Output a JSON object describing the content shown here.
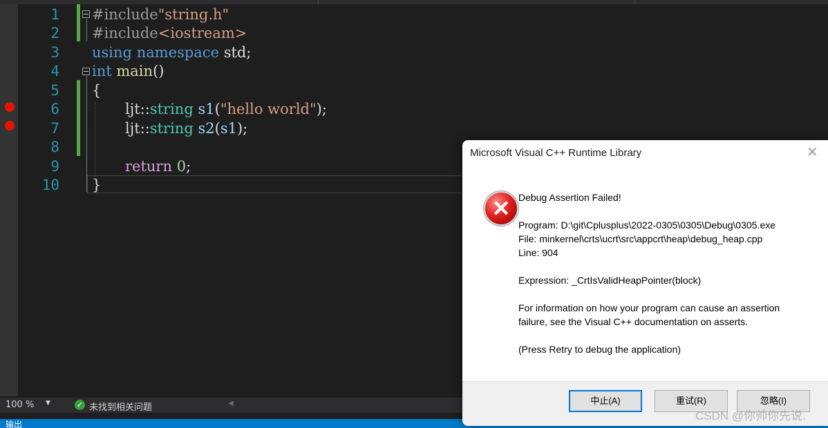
{
  "editor": {
    "lines": [
      {
        "n": "1"
      },
      {
        "n": "2"
      },
      {
        "n": "3"
      },
      {
        "n": "4"
      },
      {
        "n": "5"
      },
      {
        "n": "6"
      },
      {
        "n": "7"
      },
      {
        "n": "8"
      },
      {
        "n": "9"
      },
      {
        "n": "10"
      }
    ],
    "code": {
      "l1_directive": "#include",
      "l1_file": "\"string.h\"",
      "l2_directive": "#include",
      "l2_file": "<iostream>",
      "l3_using": "using",
      "l3_namespace": "namespace",
      "l3_std": "std;",
      "l4_int": "int",
      "l4_main": "main",
      "l4_parens": "()",
      "l5_brace": "{",
      "l6_ns": "ljt::",
      "l6_type": "string",
      "l6_var": "s1",
      "l6_open": "(",
      "l6_str": "\"hello world\"",
      "l6_close": ");",
      "l7_ns": "ljt::",
      "l7_type": "string",
      "l7_var": "s2",
      "l7_open": "(",
      "l7_arg": "s1",
      "l7_close": ");",
      "l9_return": "return",
      "l9_zero": "0",
      "l9_semi": ";",
      "l10_brace": "}"
    }
  },
  "status": {
    "zoom": "100 %",
    "issues": "未找到相关问题",
    "output_tab": "输出"
  },
  "dialog": {
    "title": "Microsoft Visual C++ Runtime Library",
    "heading": "Debug Assertion Failed!",
    "program": "Program: D:\\git\\Cplusplus\\2022-0305\\0305\\Debug\\0305.exe",
    "file": "File: minkernel\\crts\\ucrt\\src\\appcrt\\heap\\debug_heap.cpp",
    "line": "Line: 904",
    "expression": "Expression: _CrtIsValidHeapPointer(block)",
    "info1": "For information on how your program can cause an assertion",
    "info2": "failure, see the Visual C++ documentation on asserts.",
    "retry_hint": "(Press Retry to debug the application)",
    "buttons": {
      "abort": "中止(A)",
      "retry": "重试(R)",
      "ignore": "忽略(I)"
    }
  },
  "watermark": "CSDN @你帅你先说.",
  "colors": {
    "keyword": "#569cd6",
    "string": "#d69d85",
    "type": "#4ec9b0",
    "line_number": "#2b91af",
    "breakpoint": "#e51400",
    "accent": "#007acc"
  }
}
